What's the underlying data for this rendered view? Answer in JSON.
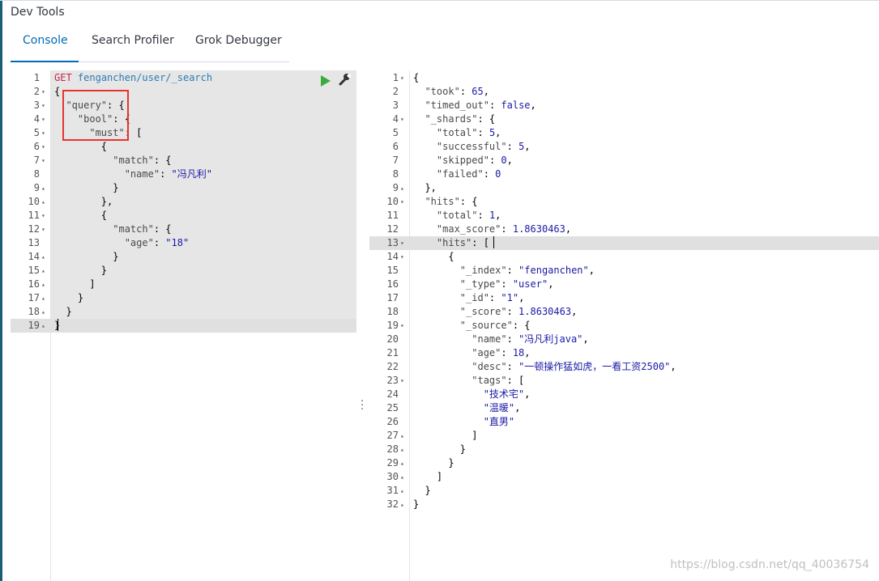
{
  "app": {
    "title": "Dev Tools"
  },
  "tabs": [
    {
      "label": "Console",
      "active": true
    },
    {
      "label": "Search Profiler",
      "active": false
    },
    {
      "label": "Grok Debugger",
      "active": false
    }
  ],
  "request": {
    "method": "GET",
    "path": "fenganchen/user/_search",
    "lines": [
      {
        "n": "1",
        "fold": "",
        "text": ""
      },
      {
        "n": "2",
        "fold": "▾",
        "text": "{"
      },
      {
        "n": "3",
        "fold": "▾",
        "text": "  \"query\": {"
      },
      {
        "n": "4",
        "fold": "▾",
        "text": "    \"bool\": {"
      },
      {
        "n": "5",
        "fold": "▾",
        "text": "      \"must\": ["
      },
      {
        "n": "6",
        "fold": "▾",
        "text": "        {"
      },
      {
        "n": "7",
        "fold": "▾",
        "text": "          \"match\": {"
      },
      {
        "n": "8",
        "fold": "",
        "text": "            \"name\": \"冯凡利\""
      },
      {
        "n": "9",
        "fold": "▴",
        "text": "          }"
      },
      {
        "n": "10",
        "fold": "▴",
        "text": "        },"
      },
      {
        "n": "11",
        "fold": "▾",
        "text": "        {"
      },
      {
        "n": "12",
        "fold": "▾",
        "text": "          \"match\": {"
      },
      {
        "n": "13",
        "fold": "",
        "text": "            \"age\": \"18\""
      },
      {
        "n": "14",
        "fold": "▴",
        "text": "          }"
      },
      {
        "n": "15",
        "fold": "▴",
        "text": "        }"
      },
      {
        "n": "16",
        "fold": "▴",
        "text": "      ]"
      },
      {
        "n": "17",
        "fold": "▴",
        "text": "    }"
      },
      {
        "n": "18",
        "fold": "▴",
        "text": "  }"
      },
      {
        "n": "19",
        "fold": "▴",
        "text": "}"
      }
    ]
  },
  "response": {
    "lines": [
      {
        "n": "1",
        "fold": "▾",
        "text": "{"
      },
      {
        "n": "2",
        "fold": "",
        "text": "  \"took\": 65,"
      },
      {
        "n": "3",
        "fold": "",
        "text": "  \"timed_out\": false,"
      },
      {
        "n": "4",
        "fold": "▾",
        "text": "  \"_shards\": {"
      },
      {
        "n": "5",
        "fold": "",
        "text": "    \"total\": 5,"
      },
      {
        "n": "6",
        "fold": "",
        "text": "    \"successful\": 5,"
      },
      {
        "n": "7",
        "fold": "",
        "text": "    \"skipped\": 0,"
      },
      {
        "n": "8",
        "fold": "",
        "text": "    \"failed\": 0"
      },
      {
        "n": "9",
        "fold": "▴",
        "text": "  },"
      },
      {
        "n": "10",
        "fold": "▾",
        "text": "  \"hits\": {"
      },
      {
        "n": "11",
        "fold": "",
        "text": "    \"total\": 1,"
      },
      {
        "n": "12",
        "fold": "",
        "text": "    \"max_score\": 1.8630463,"
      },
      {
        "n": "13",
        "fold": "▾",
        "text": "    \"hits\": ["
      },
      {
        "n": "14",
        "fold": "▾",
        "text": "      {"
      },
      {
        "n": "15",
        "fold": "",
        "text": "        \"_index\": \"fenganchen\","
      },
      {
        "n": "16",
        "fold": "",
        "text": "        \"_type\": \"user\","
      },
      {
        "n": "17",
        "fold": "",
        "text": "        \"_id\": \"1\","
      },
      {
        "n": "18",
        "fold": "",
        "text": "        \"_score\": 1.8630463,"
      },
      {
        "n": "19",
        "fold": "▾",
        "text": "        \"_source\": {"
      },
      {
        "n": "20",
        "fold": "",
        "text": "          \"name\": \"冯凡利java\","
      },
      {
        "n": "21",
        "fold": "",
        "text": "          \"age\": 18,"
      },
      {
        "n": "22",
        "fold": "",
        "text": "          \"desc\": \"一顿操作猛如虎，一看工资2500\","
      },
      {
        "n": "23",
        "fold": "▾",
        "text": "          \"tags\": ["
      },
      {
        "n": "24",
        "fold": "",
        "text": "            \"技术宅\","
      },
      {
        "n": "25",
        "fold": "",
        "text": "            \"温暖\","
      },
      {
        "n": "26",
        "fold": "",
        "text": "            \"直男\""
      },
      {
        "n": "27",
        "fold": "▴",
        "text": "          ]"
      },
      {
        "n": "28",
        "fold": "▴",
        "text": "        }"
      },
      {
        "n": "29",
        "fold": "▴",
        "text": "      }"
      },
      {
        "n": "30",
        "fold": "▴",
        "text": "    ]"
      },
      {
        "n": "31",
        "fold": "▴",
        "text": "  }"
      },
      {
        "n": "32",
        "fold": "▴",
        "text": "}"
      }
    ]
  },
  "watermark": "https://blog.csdn.net/qq_40036754",
  "colors": {
    "accent": "#006bb4",
    "method": "#c7254e",
    "run": "#3caa3c",
    "highlight_box": "#e8332d"
  },
  "icons": {
    "run": "play-icon",
    "settings": "wrench-icon",
    "resize": "vertical-dots-icon"
  }
}
